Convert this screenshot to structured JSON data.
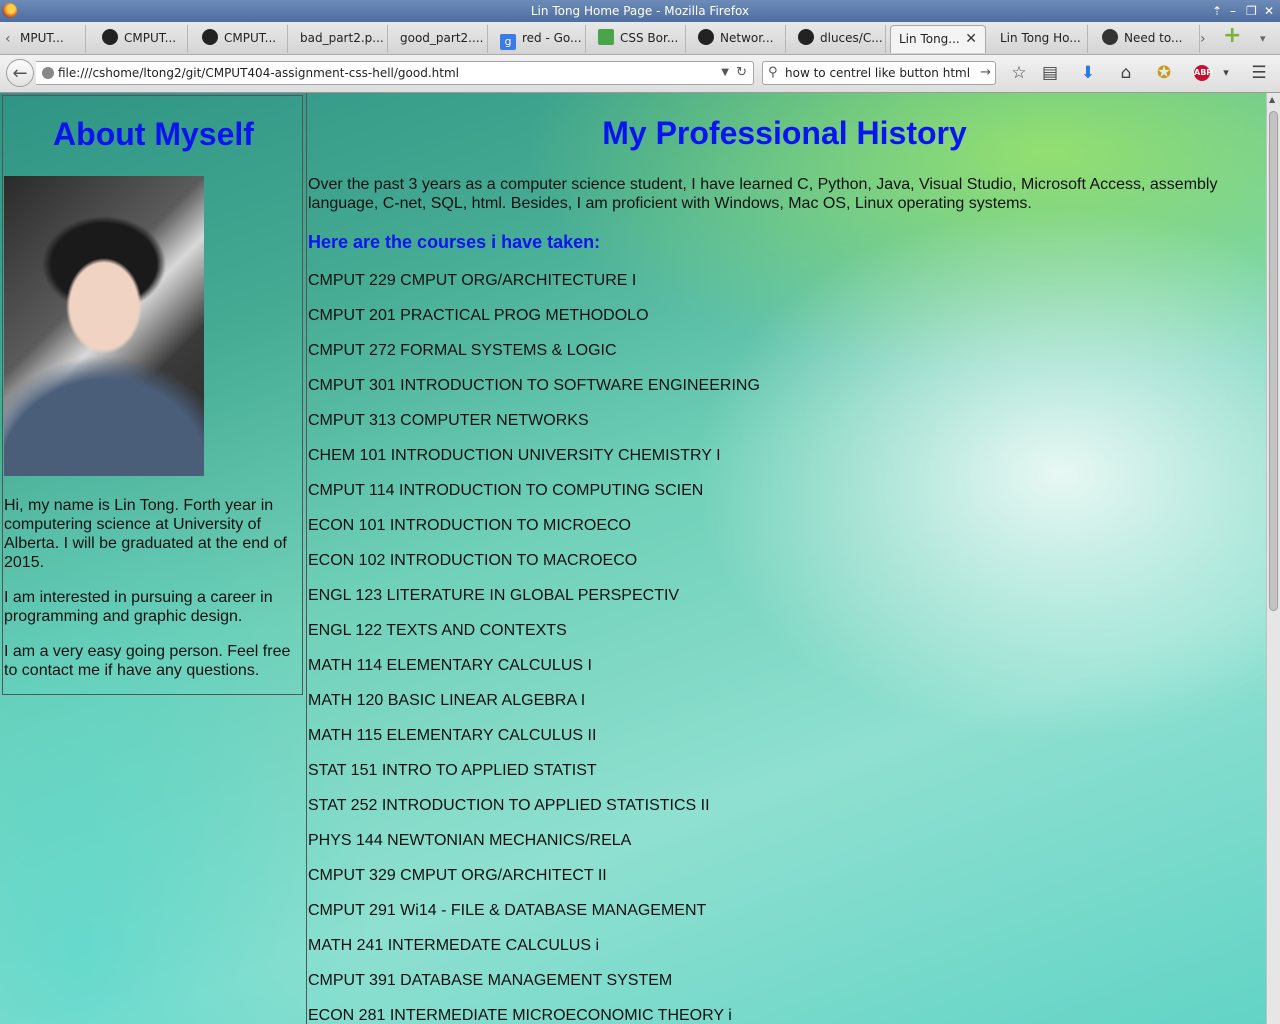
{
  "window": {
    "title": "Lin Tong Home Page - Mozilla Firefox"
  },
  "tabs": [
    {
      "label": "MPUT...",
      "icon": "none"
    },
    {
      "label": "CMPUT...",
      "icon": "github-icon"
    },
    {
      "label": "CMPUT...",
      "icon": "github-icon"
    },
    {
      "label": "bad_part2.p...",
      "icon": "none"
    },
    {
      "label": "good_part2....",
      "icon": "none"
    },
    {
      "label": "red - Go...",
      "icon": "google-icon"
    },
    {
      "label": "CSS Bor...",
      "icon": "w3schools-icon"
    },
    {
      "label": "Networ...",
      "icon": "github-icon"
    },
    {
      "label": "dluces/C...",
      "icon": "github-icon"
    },
    {
      "label": "Lin Tong...",
      "icon": "none",
      "active": true
    },
    {
      "label": "Lin Tong Ho...",
      "icon": "none"
    },
    {
      "label": "Need to...",
      "icon": "video-icon"
    }
  ],
  "navbar": {
    "url": "file:///cshome/ltong2/git/CMPUT404-assignment-css-hell/good.html",
    "search_query": "how to centrel like button html"
  },
  "page": {
    "sidebar": {
      "heading": "About Myself",
      "paragraphs": [
        "Hi, my name is Lin Tong. Forth year in computering science at University of Alberta. I will be graduated at the end of 2015.",
        "I am interested in pursuing a career in programming and graphic design.",
        "I am a very easy going person. Feel free to contact me if have any questions."
      ]
    },
    "main": {
      "heading": "My Professional History",
      "intro": "Over the past 3 years as a computer science student, I have learned C, Python, Java, Visual Studio, Microsoft Access, assembly language, C-net, SQL, html. Besides, I am proficient with Windows, Mac OS, Linux operating systems.",
      "courses_heading": "Here are the courses i have taken:",
      "courses": [
        "CMPUT 229 CMPUT ORG/ARCHITECTURE I",
        "CMPUT 201 PRACTICAL PROG METHODOLO",
        "CMPUT 272 FORMAL SYSTEMS & LOGIC",
        "CMPUT 301 INTRODUCTION TO SOFTWARE ENGINEERING",
        "CMPUT 313 COMPUTER NETWORKS",
        "CHEM 101 INTRODUCTION UNIVERSITY CHEMISTRY I",
        "CMPUT 114 INTRODUCTION TO COMPUTING SCIEN",
        "ECON 101 INTRODUCTION TO MICROECO",
        "ECON 102 INTRODUCTION TO MACROECO",
        "ENGL 123 LITERATURE IN GLOBAL PERSPECTIV",
        "ENGL 122 TEXTS AND CONTEXTS",
        "MATH 114 ELEMENTARY CALCULUS I",
        "MATH 120 BASIC LINEAR ALGEBRA I",
        "MATH 115 ELEMENTARY CALCULUS II",
        "STAT 151 INTRO TO APPLIED STATIST",
        "STAT 252 INTRODUCTION TO APPLIED STATISTICS II",
        "PHYS 144 NEWTONIAN MECHANICS/RELA",
        "CMPUT 329 CMPUT ORG/ARCHITECT II",
        "CMPUT 291 Wi14 - FILE & DATABASE MANAGEMENT",
        "MATH 241 INTERMEDATE CALCULUS i",
        "CMPUT 391 DATABASE MANAGEMENT SYSTEM",
        "ECON 281 INTERMEDIATE MICROECONOMIC THEORY i"
      ]
    }
  },
  "colors": {
    "heading": "#0a14f0",
    "text": "#111111"
  }
}
